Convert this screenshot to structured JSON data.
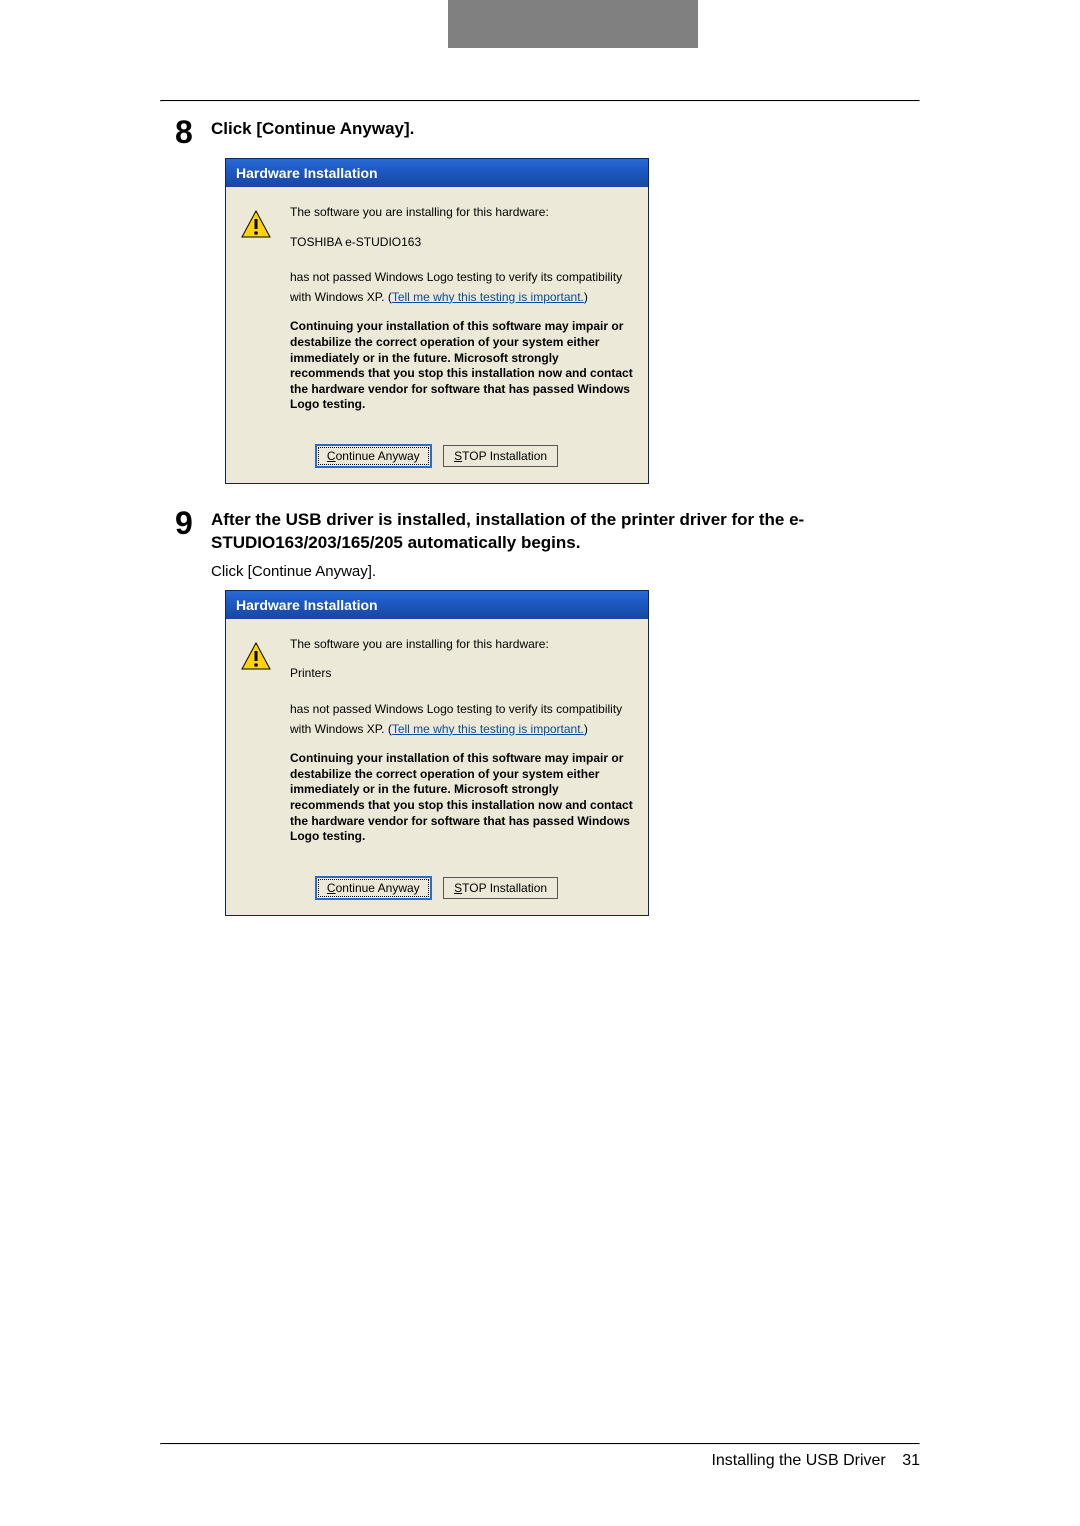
{
  "step8": {
    "num": "8",
    "title": "Click [Continue Anyway]."
  },
  "step9": {
    "num": "9",
    "title": "After the USB driver is installed, installation of the printer driver for the e-STUDIO163/203/165/205 automatically begins.",
    "bodyText": "Click [Continue Anyway]."
  },
  "dialog1": {
    "titlebar": "Hardware Installation",
    "line1": "The software you are installing for this hardware:",
    "hardwareName": "TOSHIBA e-STUDIO163",
    "compat1": "has not passed Windows Logo testing to verify its compatibility",
    "compat2a": "with Windows XP. (",
    "compat2link": "Tell me why this testing is important.",
    "compat2b": ")",
    "warnText": "Continuing your installation of this software may impair or destabilize the correct operation of your system either immediately or in the future. Microsoft strongly recommends that you stop this installation now and contact the hardware vendor for software that has passed Windows Logo testing.",
    "continueBtn": "Continue Anyway",
    "stopBtn": "STOP Installation"
  },
  "dialog2": {
    "titlebar": "Hardware Installation",
    "line1": "The software you are installing for this hardware:",
    "hardwareName": "Printers",
    "compat1": "has not passed Windows Logo testing to verify its compatibility",
    "compat2a": "with Windows XP. (",
    "compat2link": "Tell me why this testing is important.",
    "compat2b": ")",
    "warnText": "Continuing your installation of this software may impair or destabilize the correct operation of your system either immediately or in the future. Microsoft strongly recommends that you stop this installation now and contact the hardware vendor for software that has passed Windows Logo testing.",
    "continueBtn": "Continue Anyway",
    "stopBtn": "STOP Installation"
  },
  "footer": {
    "text": "Installing the USB Driver",
    "page": "31"
  }
}
